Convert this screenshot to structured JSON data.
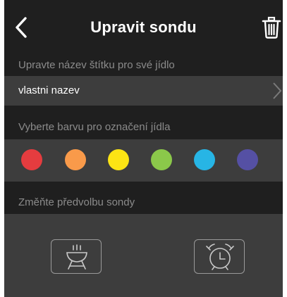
{
  "header": {
    "title": "Upravit sondu",
    "back_icon": "chevron-left-icon",
    "delete_icon": "trash-icon"
  },
  "label_section": {
    "heading": "Upravte název štítku pro své jídlo",
    "current_name": "vlastni nazev"
  },
  "color_section": {
    "heading": "Vyberte barvu pro označení jídla",
    "colors": [
      "#e53c3f",
      "#f99a4a",
      "#fce414",
      "#8bc84a",
      "#27b5e5",
      "#5550a4"
    ]
  },
  "preset_section": {
    "heading": "Změňte předvolbu sondy",
    "presets": [
      {
        "name": "grill",
        "icon": "grill-icon"
      },
      {
        "name": "alarm",
        "icon": "alarm-clock-icon"
      }
    ]
  }
}
